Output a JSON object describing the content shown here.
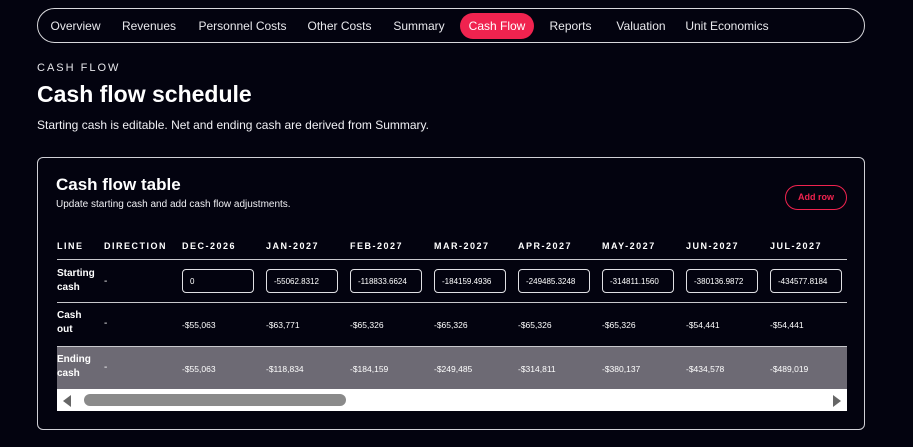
{
  "nav": {
    "items": [
      {
        "label": "Overview"
      },
      {
        "label": "Revenues"
      },
      {
        "label": "Personnel Costs"
      },
      {
        "label": "Other Costs"
      },
      {
        "label": "Summary"
      },
      {
        "label": "Cash Flow",
        "active": true
      },
      {
        "label": "Reports"
      },
      {
        "label": "Valuation"
      },
      {
        "label": "Unit Economics"
      }
    ]
  },
  "header": {
    "eyebrow": "CASH FLOW",
    "title": "Cash flow schedule",
    "description": "Starting cash is editable. Net and ending cash are derived from Summary."
  },
  "card": {
    "title": "Cash flow table",
    "description": "Update starting cash and add cash flow adjustments.",
    "add_row_label": "Add row"
  },
  "table": {
    "headers": [
      "LINE",
      "DIRECTION",
      "DEC-2026",
      "JAN-2027",
      "FEB-2027",
      "MAR-2027",
      "APR-2027",
      "MAY-2027",
      "JUN-2027",
      "JUL-2027"
    ],
    "starting_cash": {
      "label_line1": "Starting",
      "label_line2": "cash",
      "direction": "-",
      "inputs": [
        "0",
        "-55062.8312",
        "-118833.6624",
        "-184159.4936",
        "-249485.3248",
        "-314811.1560",
        "-380136.9872",
        "-434577.8184"
      ]
    },
    "cash_out": {
      "label_line1": "Cash",
      "label_line2": "out",
      "direction": "-",
      "values": [
        "-$55,063",
        "-$63,771",
        "-$65,326",
        "-$65,326",
        "-$65,326",
        "-$65,326",
        "-$54,441",
        "-$54,441"
      ]
    },
    "ending_cash": {
      "label_line1": "Ending",
      "label_line2": "cash",
      "direction": "-",
      "values": [
        "-$55,063",
        "-$118,834",
        "-$184,159",
        "-$249,485",
        "-$314,811",
        "-$380,137",
        "-$434,578",
        "-$489,019"
      ]
    }
  },
  "colors": {
    "background": "#03030f",
    "accent": "#f0234f",
    "ending_row": "#6d6a74"
  }
}
